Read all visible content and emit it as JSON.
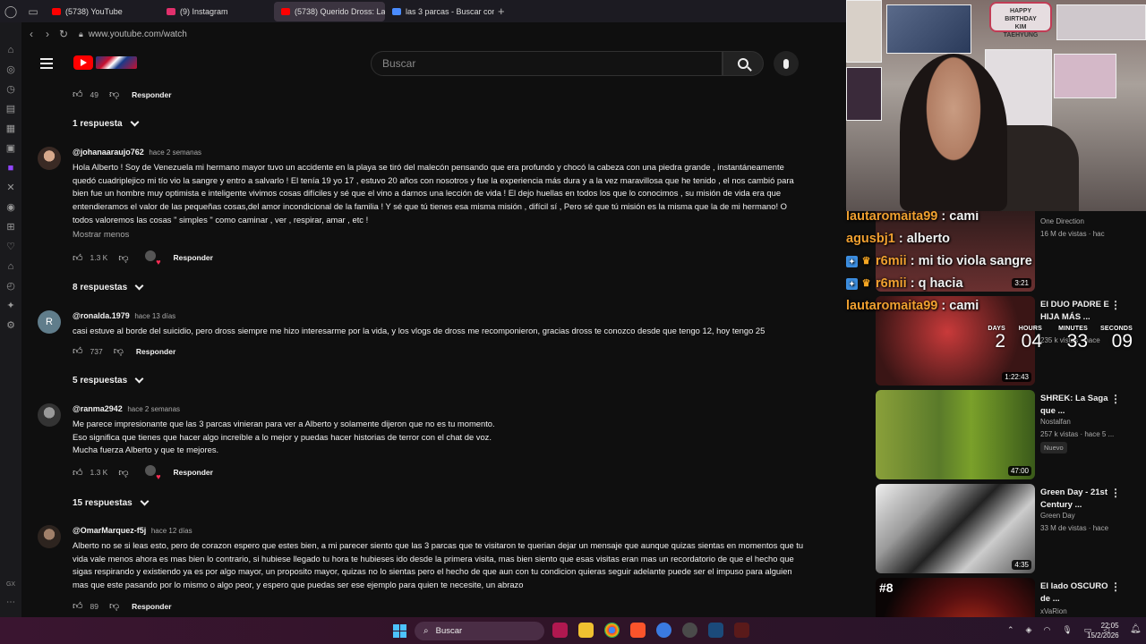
{
  "browser": {
    "tabs": [
      {
        "label": "(5738) YouTube",
        "color": "#ff0000"
      },
      {
        "label": "(9) Instagram",
        "color": "#e1306c"
      },
      {
        "label": "(5738) Querido Dross: La",
        "color": "#ff0000"
      },
      {
        "label": "las 3 parcas - Buscar con",
        "color": "#4a8cff"
      }
    ],
    "active_tab": 2,
    "url": "www.youtube.com/watch"
  },
  "header": {
    "search_placeholder": "Buscar"
  },
  "comments": {
    "top_row": {
      "likes": "49",
      "reply_label": "Responder"
    },
    "top_replies": "1 respuesta",
    "items": [
      {
        "user": "@johanaaraujo762",
        "time": "hace 2 semanas",
        "lines": [
          "Hola Alberto ! Soy de Venezuela mi hermano mayor tuvo un accidente en la playa se tiró del malecón pensando que era profundo y chocó la cabeza con una piedra grande , instantáneamente",
          "quedó cuadriplejico mi tío vio la sangre y entro a salvarlo ! El tenía 19 yo 17 ,  estuvo 20 años con nosotros y fue la experiencia más dura y a la vez maravillosa que he tenido , el nos cambió para",
          "bien fue un hombre muy optimista e inteligente vivimos cosas difíciles y sé que el vino a darnos una lección de vida ! El dejo huellas en todos los que lo conocimos , su misión de vida era que",
          "entendieramos el valor de las pequeñas cosas,del amor incondicional de la familia ! Y sé que tú tienes esa misma misión , difícil sí , Pero sé que tú misión es la misma que la de mi hermano! O",
          "todos valoremos las cosas \" simples \" como caminar , ver , respirar, amar , etc !"
        ],
        "show_less": "Mostrar menos",
        "likes": "1.3 K",
        "reply_label": "Responder",
        "replies": "8 respuestas"
      },
      {
        "user": "@ronalda.1979",
        "time": "hace 13 días",
        "lines": [
          "casi estuve al borde del suicidio, pero dross siempre me hizo interesarme por la vida, y los vlogs de dross me recomponieron, gracias dross te conozco desde que tengo 12, hoy tengo 25"
        ],
        "likes": "737",
        "reply_label": "Responder",
        "replies": "5 respuestas",
        "avatar_letter": "R"
      },
      {
        "user": "@ranma2942",
        "time": "hace 2 semanas",
        "lines": [
          "Me parece impresionante que las 3 parcas vinieran para ver a Alberto y solamente dijeron que no es tu momento.",
          "Eso significa que tienes que hacer algo increíble a lo mejor y puedas hacer historias de terror con el chat de voz.",
          "Mucha fuerza Alberto y que te mejores."
        ],
        "likes": "1.3 K",
        "reply_label": "Responder",
        "replies": "15 respuestas"
      },
      {
        "user": "@OmarMarquez-f5j",
        "time": "hace 12 días",
        "lines": [
          "Alberto no se si leas esto, pero de corazon espero que estes bien, a mi parecer siento que las 3 parcas que te visitaron te querian dejar un mensaje que aunque quizas sientas en momentos que tu",
          "vida vale menos ahora es mas bien lo contrario, si hubiese llegado tu hora te hubieses ido desde la primera visita, mas bien siento que esas visitas eran mas un recordatorio de que el hecho que",
          "sigas respirando y existiendo ya es por algo mayor, un proposito mayor, quizas no lo sientas pero el hecho de que aun con tu condicion quieras seguir adelante puede ser el impuso para alguien",
          "mas que este pasando por lo mismo o algo peor, y espero que puedas ser ese ejemplo para quien te necesite, un abrazo"
        ],
        "likes": "89",
        "reply_label": "Responder"
      }
    ]
  },
  "webcam": {
    "banner": "HAPPY\nBIRTHDAY\nKIM\nTAEHYUNG"
  },
  "chat": [
    {
      "user": "lautaromaita99",
      "msg": "cami",
      "color": "#f0a030",
      "badges": false
    },
    {
      "user": "agusbj1",
      "msg": "alberto",
      "color": "#f0a030",
      "badges": false
    },
    {
      "user": "r6mii",
      "msg": "mi tio viola sangre",
      "color": "#f0a030",
      "badges": true
    },
    {
      "user": "r6mii",
      "msg": "q hacia",
      "color": "#f0a030",
      "badges": true
    },
    {
      "user": "lautaromaita99",
      "msg": "cami",
      "color": "#f0a030",
      "badges": false
    }
  ],
  "countdown": {
    "days": {
      "label": "DAYS",
      "value": "2"
    },
    "hours": {
      "label": "HOURS",
      "value": "04"
    },
    "minutes": {
      "label": "MINUTES",
      "value": "33"
    },
    "seconds": {
      "label": "SECONDS",
      "value": "09"
    }
  },
  "suggestions": [
    {
      "title": "",
      "channel": "One Direction",
      "meta": "16 M de vistas · hac",
      "duration": "3:21",
      "thumb": "#3a2020"
    },
    {
      "title": "El DUO PADRE E HIJA MÁS ...",
      "channel": "",
      "meta": "235 k vistas · hace",
      "duration": "1:22:43",
      "thumb": "#8a2a2a"
    },
    {
      "title": "SHREK: La Saga que ...",
      "channel": "Nostalfan",
      "meta": "257 k vistas · hace 5 ...",
      "duration": "47:00",
      "tag": "Nuevo",
      "thumb": "#6b8a2a"
    },
    {
      "title": "Green Day - 21st Century ...",
      "channel": "Green Day",
      "meta": "33 M de vistas · hace",
      "duration": "4:35",
      "thumb": "#bbbbbb"
    },
    {
      "title": "El lado OSCURO de ...",
      "channel": "xVaRion",
      "meta": "",
      "duration": "",
      "rank": "#8",
      "thumb": "#1a0a0a"
    }
  ],
  "taskbar": {
    "search": "Buscar",
    "time": "22:05",
    "date": "15/2/2026"
  }
}
